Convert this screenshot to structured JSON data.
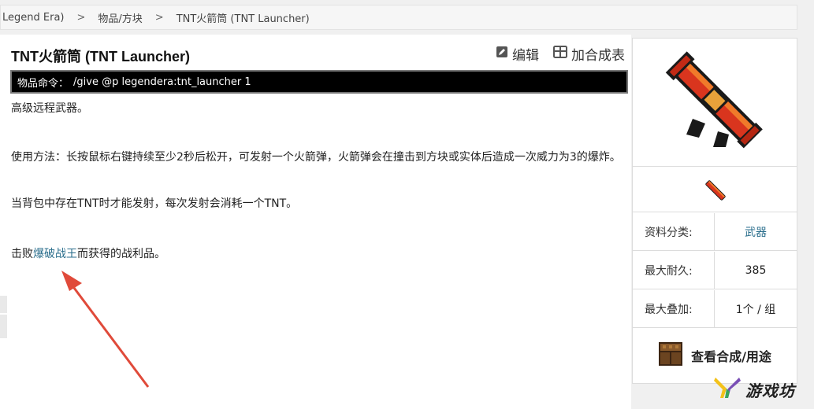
{
  "breadcrumb": {
    "items": [
      "Legend Era)",
      "物品/方块",
      "TNT火箭筒 (TNT Launcher)"
    ],
    "separator": ">"
  },
  "page": {
    "title": "TNT火箭筒 (TNT Launcher)",
    "actions": {
      "edit": "编辑",
      "recipe": "加合成表"
    }
  },
  "command": {
    "label": "物品命令：",
    "value": "/give @p legendera:tnt_launcher 1"
  },
  "description": {
    "summary": "高级远程武器。",
    "usage": "使用方法：长按鼠标右键持续至少2秒后松开，可发射一个火箭弹，火箭弹会在撞击到方块或实体后造成一次威力为3的爆炸。",
    "requirement": "当背包中存在TNT时才能发射，每次发射会消耗一个TNT。",
    "drop_prefix": "击败",
    "drop_link": "爆破战王",
    "drop_suffix": "而获得的战利品。"
  },
  "infobox": {
    "rows": [
      {
        "label": "资料分类:",
        "value": "武器"
      },
      {
        "label": "最大耐久:",
        "value": "385"
      },
      {
        "label": "最大叠加:",
        "value": "1个 / 组"
      }
    ],
    "craft_label": "查看合成/用途",
    "item_icon": "tnt-launcher-icon",
    "craft_icon": "crafting-table-icon"
  },
  "watermark": {
    "text": "游戏坊"
  },
  "colors": {
    "link": "#2a6e8c",
    "command_bg": "#000000",
    "arrow": "#e04a3a"
  }
}
